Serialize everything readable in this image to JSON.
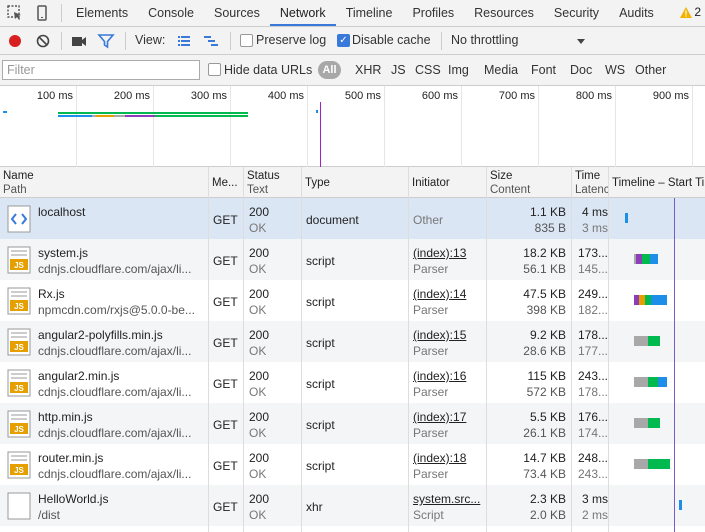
{
  "tabs": [
    "Elements",
    "Console",
    "Sources",
    "Network",
    "Timeline",
    "Profiles",
    "Resources",
    "Security",
    "Audits"
  ],
  "active_tab": "Network",
  "warnings": {
    "count": "2"
  },
  "toolbar": {
    "view_label": "View:",
    "preserve_log": "Preserve log",
    "disable_cache": "Disable cache",
    "throttling": "No throttling"
  },
  "filter": {
    "placeholder": "Filter",
    "hide_data_urls": "Hide data URLs",
    "all": "All",
    "types": [
      "XHR",
      "JS",
      "CSS",
      "Img",
      "Media",
      "Font",
      "Doc",
      "WS",
      "Other"
    ]
  },
  "overview": {
    "ticks": [
      "100 ms",
      "200 ms",
      "300 ms",
      "400 ms",
      "500 ms",
      "600 ms",
      "700 ms",
      "800 ms",
      "900 ms"
    ]
  },
  "columns": {
    "name": "Name",
    "path": "Path",
    "method": "Me...",
    "status": "Status",
    "status_text": "Text",
    "type": "Type",
    "initiator": "Initiator",
    "size": "Size",
    "content": "Content",
    "time": "Time",
    "latency": "Latenc",
    "timeline": "Timeline – Start Time"
  },
  "rows": [
    {
      "name": "localhost",
      "path": "",
      "method": "GET",
      "status": "200",
      "status_text": "OK",
      "type": "document",
      "initiator": "Other",
      "initiator_sub": "",
      "size": "1.1 KB",
      "content": "835 B",
      "time": "4 ms",
      "latency": "3 ms",
      "icon": "html-file-icon"
    },
    {
      "name": "system.js",
      "path": "cdnjs.cloudflare.com/ajax/li...",
      "method": "GET",
      "status": "200",
      "status_text": "OK",
      "type": "script",
      "initiator": "(index):13",
      "initiator_sub": "Parser",
      "size": "18.2 KB",
      "content": "56.1 KB",
      "time": "173...",
      "latency": "145...",
      "icon": "js-file-icon"
    },
    {
      "name": "Rx.js",
      "path": "npmcdn.com/rxjs@5.0.0-be...",
      "method": "GET",
      "status": "200",
      "status_text": "OK",
      "type": "script",
      "initiator": "(index):14",
      "initiator_sub": "Parser",
      "size": "47.5 KB",
      "content": "398 KB",
      "time": "249...",
      "latency": "182...",
      "icon": "js-file-icon"
    },
    {
      "name": "angular2-polyfills.min.js",
      "path": "cdnjs.cloudflare.com/ajax/li...",
      "method": "GET",
      "status": "200",
      "status_text": "OK",
      "type": "script",
      "initiator": "(index):15",
      "initiator_sub": "Parser",
      "size": "9.2 KB",
      "content": "28.6 KB",
      "time": "178...",
      "latency": "177...",
      "icon": "js-file-icon"
    },
    {
      "name": "angular2.min.js",
      "path": "cdnjs.cloudflare.com/ajax/li...",
      "method": "GET",
      "status": "200",
      "status_text": "OK",
      "type": "script",
      "initiator": "(index):16",
      "initiator_sub": "Parser",
      "size": "115 KB",
      "content": "572 KB",
      "time": "243...",
      "latency": "178...",
      "icon": "js-file-icon"
    },
    {
      "name": "http.min.js",
      "path": "cdnjs.cloudflare.com/ajax/li...",
      "method": "GET",
      "status": "200",
      "status_text": "OK",
      "type": "script",
      "initiator": "(index):17",
      "initiator_sub": "Parser",
      "size": "5.5 KB",
      "content": "26.1 KB",
      "time": "176...",
      "latency": "174...",
      "icon": "js-file-icon"
    },
    {
      "name": "router.min.js",
      "path": "cdnjs.cloudflare.com/ajax/li...",
      "method": "GET",
      "status": "200",
      "status_text": "OK",
      "type": "script",
      "initiator": "(index):18",
      "initiator_sub": "Parser",
      "size": "14.7 KB",
      "content": "73.4 KB",
      "time": "248...",
      "latency": "243...",
      "icon": "js-file-icon"
    },
    {
      "name": "HelloWorld.js",
      "path": "/dist",
      "method": "GET",
      "status": "200",
      "status_text": "OK",
      "type": "xhr",
      "initiator": "system.src...",
      "initiator_sub": "Script",
      "size": "2.3 KB",
      "content": "2.0 KB",
      "time": "3 ms",
      "latency": "2 ms",
      "icon": "blank-file-icon"
    }
  ],
  "colors": {
    "accent": "#3879d9",
    "record": "#d92020",
    "js_icon": "#e5a000",
    "html_icon": "#3879d9",
    "wait": "#a8a8a8",
    "receive_green": "#00b94f",
    "receive_blue": "#1e8fe8",
    "dom_line": "#7a5cc5"
  }
}
